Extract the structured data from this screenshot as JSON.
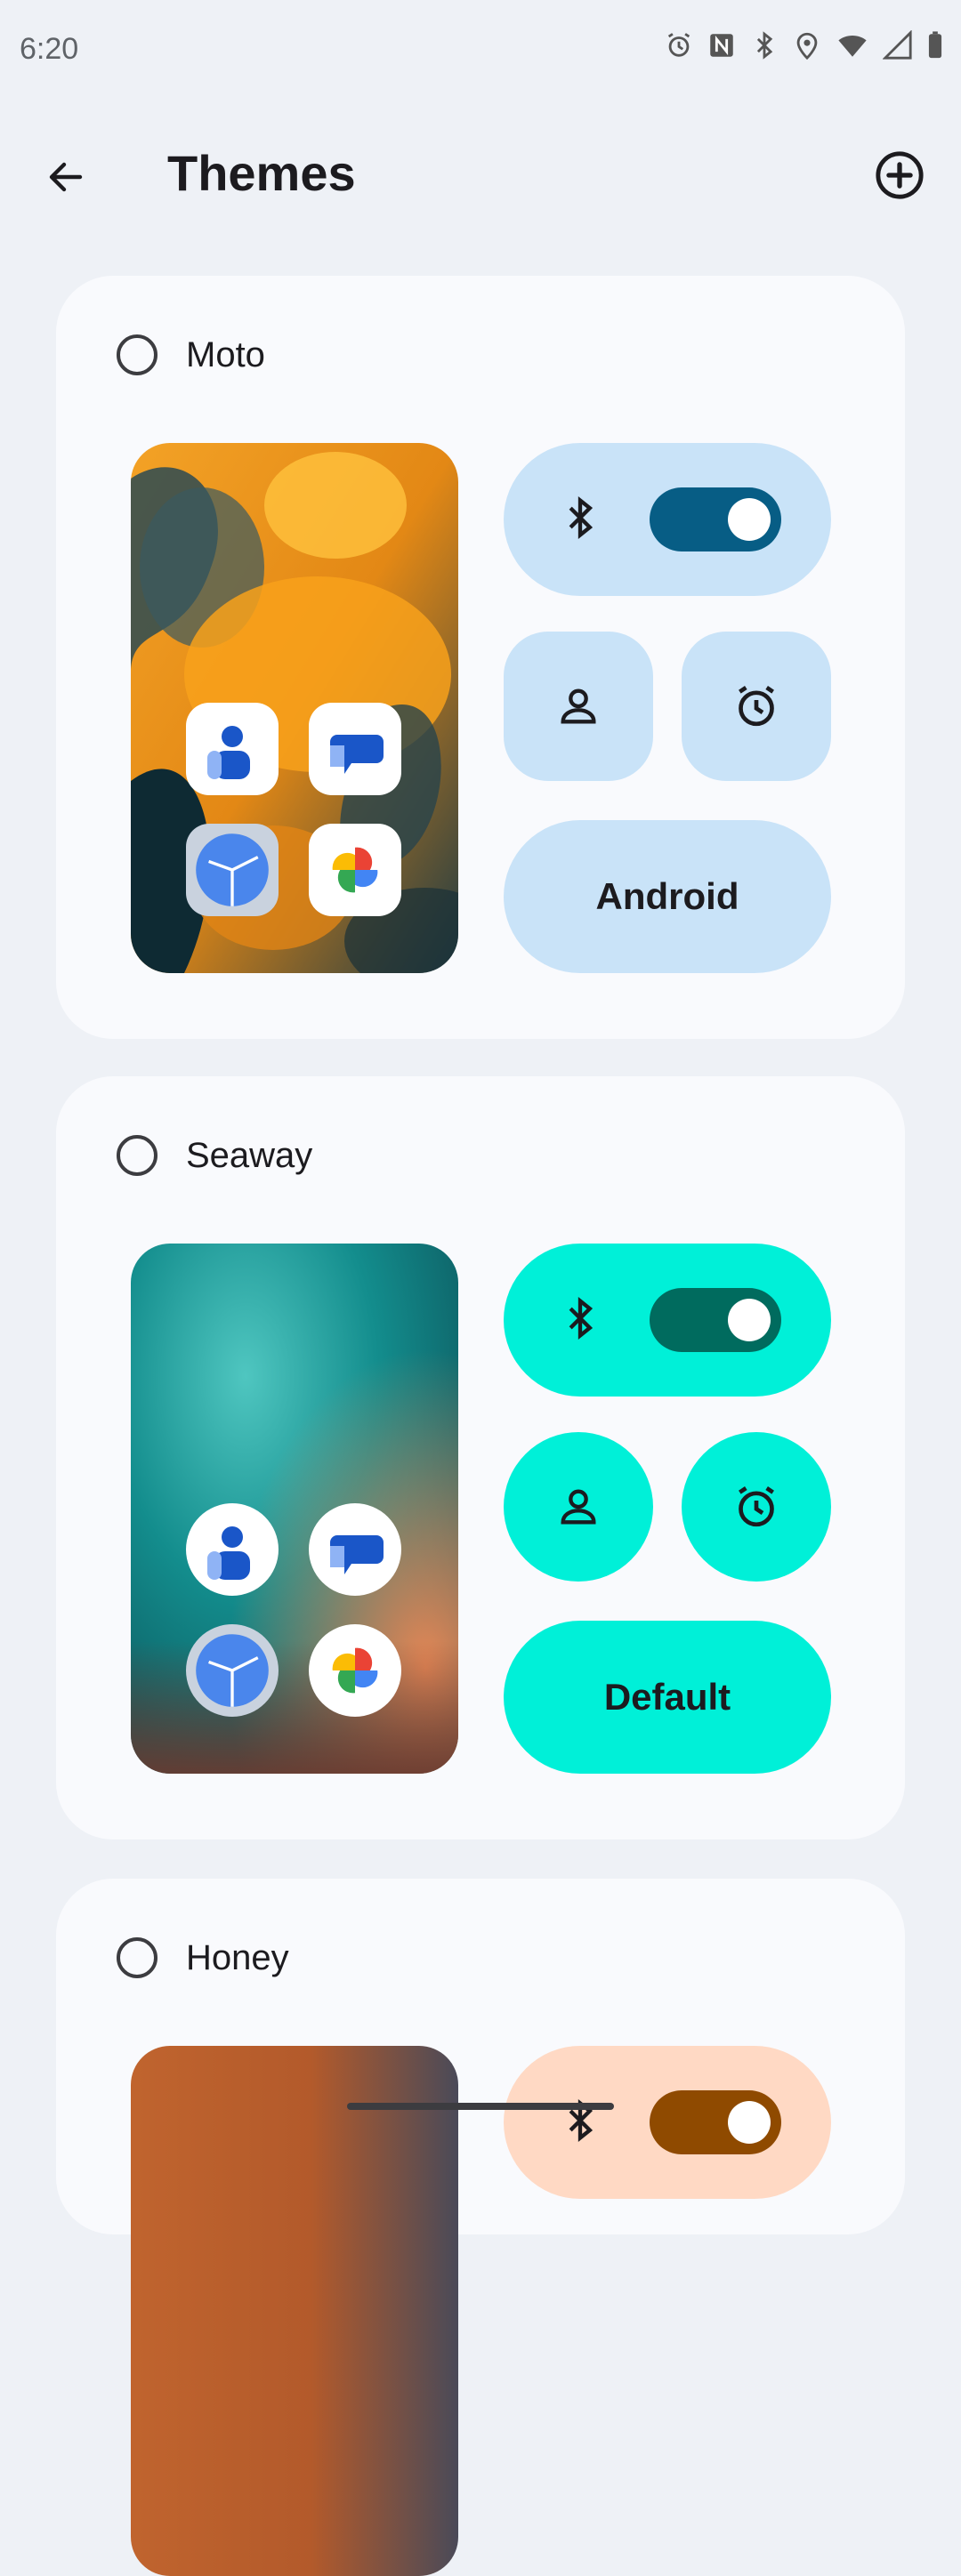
{
  "status_bar": {
    "time": "6:20",
    "icons": [
      "alarm-icon",
      "nfc-icon",
      "bluetooth-icon",
      "location-icon",
      "wifi-icon",
      "signal-icon",
      "battery-icon"
    ]
  },
  "app_bar": {
    "title": "Themes",
    "back_icon": "arrow-left-icon",
    "add_icon": "add-circle-icon"
  },
  "themes": [
    {
      "name": "Moto",
      "selected": false,
      "tile_color": "#c9e3f8",
      "toggle_color": "#075d85",
      "shape_label": "Android",
      "tile_shape": "squircle",
      "wallpaper": "orange-abstract"
    },
    {
      "name": "Seaway",
      "selected": false,
      "tile_color": "#00f0d8",
      "toggle_color": "#006b5e",
      "shape_label": "Default",
      "tile_shape": "circle",
      "wallpaper": "teal-gradient"
    },
    {
      "name": "Honey",
      "selected": false,
      "tile_color": "#ffd9c4",
      "toggle_color": "#8f4a00",
      "wallpaper": "copper-gradient"
    }
  ],
  "preview_apps": [
    "contacts-icon",
    "messages-icon",
    "clock-icon",
    "photos-icon"
  ]
}
